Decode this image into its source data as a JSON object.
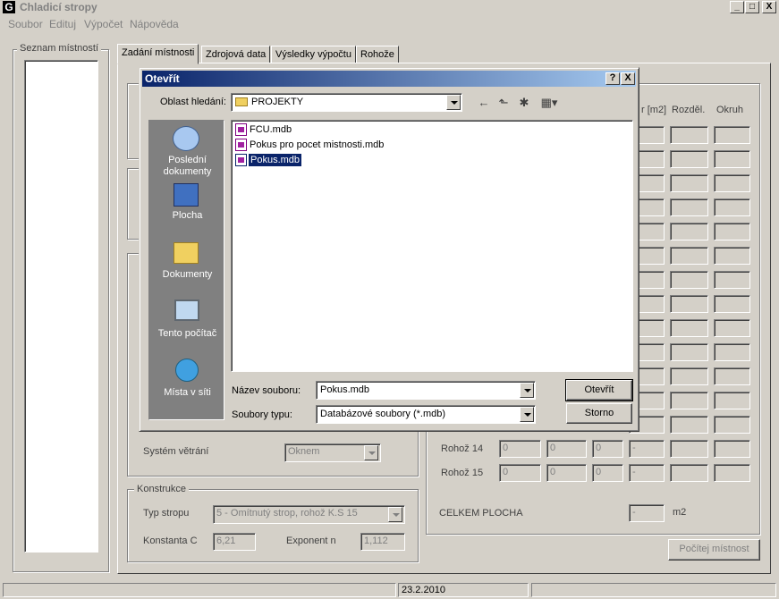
{
  "app": {
    "title": "Chladicí stropy",
    "icon_letter": "G"
  },
  "window_buttons": {
    "minimize": "_",
    "maximize": "□",
    "close": "X"
  },
  "menu": [
    "Soubor",
    "Edituj",
    "Výpočet",
    "Nápověda"
  ],
  "room_list": {
    "label": "Seznam místností"
  },
  "tabs": [
    "Zadání místnosti",
    "Zdrojová data",
    "Výsledky výpočtu",
    "Rohože"
  ],
  "right_panel": {
    "col_area": "r [m2]",
    "col_rozdel": "Rozděl.",
    "col_okruh": "Okruh",
    "rows": [
      {
        "label": "Rohož 14",
        "v1": "0",
        "v2": "0",
        "v3": "0",
        "v4": "-"
      },
      {
        "label": "Rohož 15",
        "v1": "0",
        "v2": "0",
        "v3": "0",
        "v4": "-"
      }
    ],
    "total_label": "CELKEM PLOCHA",
    "total_value": "-",
    "total_unit": "m2",
    "calc_button": "Počítej místnost"
  },
  "ventilation": {
    "label": "Systém větrání",
    "value": "Oknem"
  },
  "construction": {
    "group_label": "Konstrukce",
    "ceiling_type_label": "Typ stropu",
    "ceiling_type_value": "5 - Omítnutý strop, rohož K.S 15",
    "constant_label": "Konstanta C",
    "constant_value": "6,21",
    "exponent_label": "Exponent n",
    "exponent_value": "1,112"
  },
  "status": {
    "date": "23.2.2010"
  },
  "dialog": {
    "title": "Otevřít",
    "help": "?",
    "close": "X",
    "look_in_label": "Oblast hledání:",
    "look_in_value": "PROJEKTY",
    "places": [
      {
        "label": "Poslední dokumenty",
        "icon": "recent-icon"
      },
      {
        "label": "Plocha",
        "icon": "desktop-icon"
      },
      {
        "label": "Dokumenty",
        "icon": "documents-icon"
      },
      {
        "label": "Tento počítač",
        "icon": "computer-icon"
      },
      {
        "label": "Místa v síti",
        "icon": "network-icon"
      }
    ],
    "files": [
      "FCU.mdb",
      "Pokus pro pocet mistnosti.mdb",
      "Pokus.mdb"
    ],
    "selected_file": "Pokus.mdb",
    "filename_label": "Název souboru:",
    "filename_value": "Pokus.mdb",
    "filetype_label": "Soubory typu:",
    "filetype_value": "Databázové soubory (*.mdb)",
    "open_button": "Otevřít",
    "cancel_button": "Storno"
  }
}
